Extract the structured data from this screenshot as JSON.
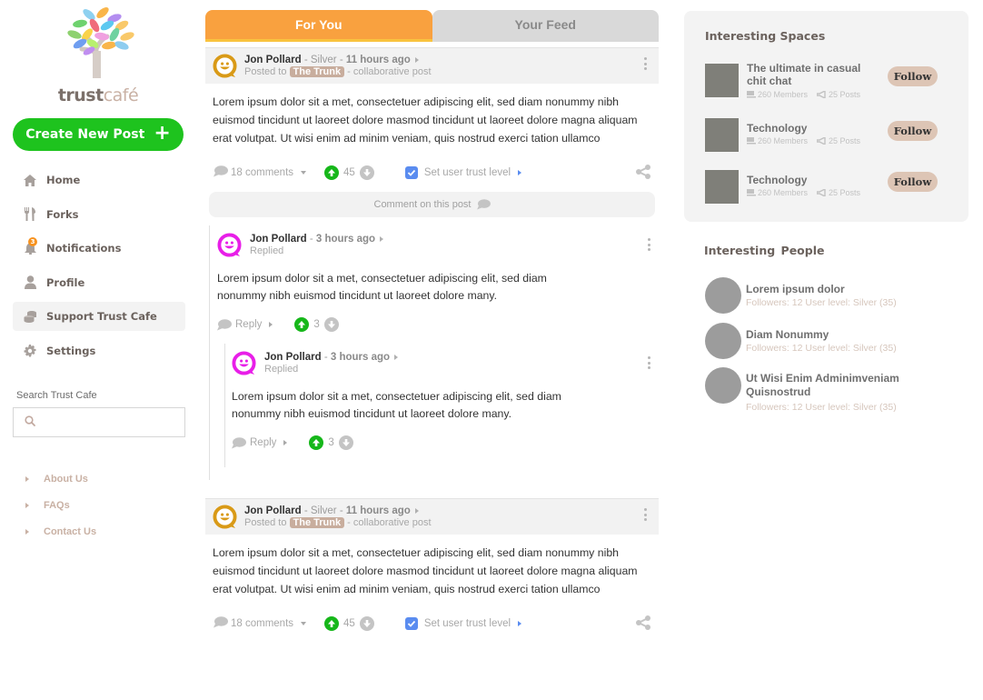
{
  "brand": {
    "name_part1": "trust",
    "name_part2": "café"
  },
  "sidebar": {
    "create_button": "Create New Post",
    "create_icon": "plus-icon",
    "nav": [
      {
        "label": "Home",
        "icon": "home-icon"
      },
      {
        "label": "Forks",
        "icon": "fork-knife-icon"
      },
      {
        "label": "Notifications",
        "icon": "bell-icon",
        "badge": "3"
      },
      {
        "label": "Profile",
        "icon": "user-icon"
      },
      {
        "label": "Support Trust Cafe",
        "icon": "coins-icon",
        "active": true
      },
      {
        "label": "Settings",
        "icon": "gear-icon"
      }
    ],
    "search_label": "Search Trust Cafe",
    "search_placeholder": "",
    "search_value": "",
    "footer_links": [
      "About Us",
      "FAQs",
      "Contact Us"
    ]
  },
  "feed": {
    "tabs": [
      {
        "label": "For You",
        "active": true
      },
      {
        "label": "Your Feed",
        "active": false
      }
    ],
    "comment_bar_label": "Comment on this post",
    "posts": [
      {
        "author": "Jon Pollard",
        "level": "Silver",
        "time": "11 hours ago",
        "posted_to_prefix": "Posted to",
        "space": "The Trunk",
        "post_type": "- collaborative post",
        "body": "Lorem ipsum dolor sit a met, consectetuer adipiscing elit, sed diam nonummy nibh euismod tincidunt ut laoreet dolore masmod tincidunt ut laoreet dolore magna aliquam erat volutpat. Ut wisi enim ad minim veniam, quis nostrud exerci tation ullamco",
        "comments_label": "18 comments",
        "votes": "45",
        "trust_label": "Set user trust level",
        "comments": [
          {
            "author": "Jon Pollard",
            "time": "3 hours ago",
            "action": "Replied",
            "body": "Lorem ipsum dolor sit a met, consectetuer adipiscing elit, sed diam nonummy nibh euismod tincidunt ut laoreet dolore many.",
            "reply_label": "Reply",
            "votes": "3",
            "replies": [
              {
                "author": "Jon Pollard",
                "time": "3 hours ago",
                "action": "Replied",
                "body": "Lorem ipsum dolor sit a met, consectetuer adipiscing elit, sed diam nonummy nibh euismod tincidunt ut laoreet dolore many.",
                "reply_label": "Reply",
                "votes": "3"
              }
            ]
          }
        ]
      },
      {
        "author": "Jon Pollard",
        "level": "Silver",
        "time": "11 hours ago",
        "posted_to_prefix": "Posted to",
        "space": "The Trunk",
        "post_type": "- collaborative post",
        "body": "Lorem ipsum dolor sit a met, consectetuer adipiscing elit, sed diam nonummy nibh euismod tincidunt ut laoreet dolore masmod tincidunt ut laoreet dolore magna aliquam erat volutpat. Ut wisi enim ad minim veniam, quis nostrud exerci tation ullamco",
        "comments_label": "18 comments",
        "votes": "45",
        "trust_label": "Set user trust level"
      }
    ]
  },
  "right": {
    "spaces_title": "Interesting Spaces",
    "follow_label": "Follow",
    "spaces": [
      {
        "name": "The ultimate in casual chit chat",
        "members": "260 Members",
        "posts": "25 Posts"
      },
      {
        "name": "Technology",
        "members": "260 Members",
        "posts": "25 Posts"
      },
      {
        "name": "Technology",
        "members": "260 Members",
        "posts": "25 Posts"
      }
    ],
    "people_title": "Interesting  People",
    "people": [
      {
        "name": "Lorem ipsum dolor",
        "stats": "Followers: 12 User level: Silver (35)"
      },
      {
        "name": "Diam Nonummy",
        "stats": "Followers: 12 User level: Silver (35)"
      },
      {
        "name": "Ut Wisi Enim Adminimveniam Quisnostrud",
        "stats": "Followers: 12 User level: Silver (35)"
      }
    ]
  },
  "colors": {
    "accent_orange": "#f9a13f",
    "create_green": "#1ec31e",
    "upvote_green": "#16b71a",
    "trust_blue": "#5a8cf0",
    "space_tag": "#c8ad9d",
    "follow_bg": "#ddc5b5",
    "post_avatar": "#d99a17",
    "comment_avatar": "#e81ee8"
  }
}
